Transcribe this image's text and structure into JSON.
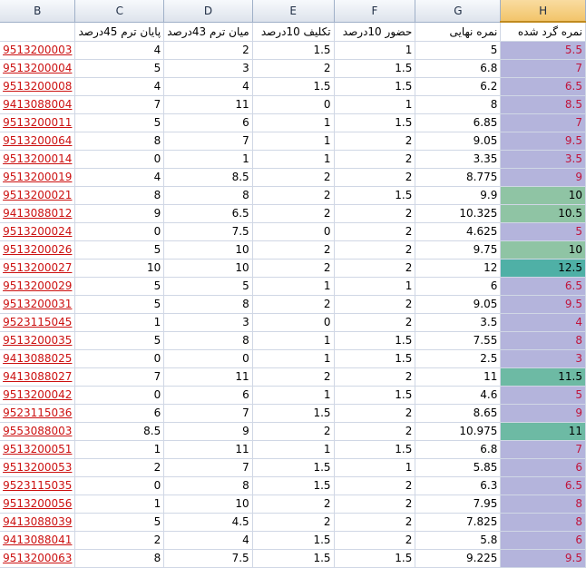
{
  "columns": [
    "B",
    "C",
    "D",
    "E",
    "F",
    "G",
    "H"
  ],
  "header_row": [
    "",
    "پایان ترم 45درصد",
    "میان ترم 43درصد",
    "تکلیف 10درصد",
    "حضور 10درصد",
    "نمره نهایی",
    "نمره گرد شده"
  ],
  "colors": {
    "default_fill": "#b4b4dc",
    "green_light": "#8fc4a4",
    "green_mid": "#6dbaa4",
    "teal": "#4fb0a6",
    "red_text": "#c0143c",
    "black_text": "#000000",
    "link_text": "#cc1111",
    "selected_header": "#f2c46a"
  },
  "rows": [
    {
      "b": "9513200003",
      "c": "4",
      "d": "2",
      "e": "1.5",
      "f": "1",
      "g": "5",
      "h": "5.5",
      "fill": "#b4b4dc",
      "ink": "#c0143c"
    },
    {
      "b": "9513200004",
      "c": "5",
      "d": "3",
      "e": "2",
      "f": "1.5",
      "g": "6.8",
      "h": "7",
      "fill": "#b4b4dc",
      "ink": "#c0143c"
    },
    {
      "b": "9513200008",
      "c": "4",
      "d": "4",
      "e": "1.5",
      "f": "1.5",
      "g": "6.2",
      "h": "6.5",
      "fill": "#b4b4dc",
      "ink": "#c0143c"
    },
    {
      "b": "9413088004",
      "c": "7",
      "d": "11",
      "e": "0",
      "f": "1",
      "g": "8",
      "h": "8.5",
      "fill": "#b4b4dc",
      "ink": "#c0143c"
    },
    {
      "b": "9513200011",
      "c": "5",
      "d": "6",
      "e": "1",
      "f": "1.5",
      "g": "6.85",
      "h": "7",
      "fill": "#b4b4dc",
      "ink": "#c0143c"
    },
    {
      "b": "9513200064",
      "c": "8",
      "d": "7",
      "e": "1",
      "f": "2",
      "g": "9.05",
      "h": "9.5",
      "fill": "#b4b4dc",
      "ink": "#c0143c"
    },
    {
      "b": "9513200014",
      "c": "0",
      "d": "1",
      "e": "1",
      "f": "2",
      "g": "3.35",
      "h": "3.5",
      "fill": "#b4b4dc",
      "ink": "#c0143c"
    },
    {
      "b": "9513200019",
      "c": "4",
      "d": "8.5",
      "e": "2",
      "f": "2",
      "g": "8.775",
      "h": "9",
      "fill": "#b4b4dc",
      "ink": "#c0143c"
    },
    {
      "b": "9513200021",
      "c": "8",
      "d": "8",
      "e": "2",
      "f": "1.5",
      "g": "9.9",
      "h": "10",
      "fill": "#8fc4a4",
      "ink": "#000000"
    },
    {
      "b": "9413088012",
      "c": "9",
      "d": "6.5",
      "e": "2",
      "f": "2",
      "g": "10.325",
      "h": "10.5",
      "fill": "#8fc4a4",
      "ink": "#000000"
    },
    {
      "b": "9513200024",
      "c": "0",
      "d": "7.5",
      "e": "0",
      "f": "2",
      "g": "4.625",
      "h": "5",
      "fill": "#b4b4dc",
      "ink": "#c0143c"
    },
    {
      "b": "9513200026",
      "c": "5",
      "d": "10",
      "e": "2",
      "f": "2",
      "g": "9.75",
      "h": "10",
      "fill": "#8fc4a4",
      "ink": "#000000"
    },
    {
      "b": "9513200027",
      "c": "10",
      "d": "10",
      "e": "2",
      "f": "2",
      "g": "12",
      "h": "12.5",
      "fill": "#4fb0a6",
      "ink": "#000000"
    },
    {
      "b": "9513200029",
      "c": "5",
      "d": "5",
      "e": "1",
      "f": "1",
      "g": "6",
      "h": "6.5",
      "fill": "#b4b4dc",
      "ink": "#c0143c"
    },
    {
      "b": "9513200031",
      "c": "5",
      "d": "8",
      "e": "2",
      "f": "2",
      "g": "9.05",
      "h": "9.5",
      "fill": "#b4b4dc",
      "ink": "#c0143c"
    },
    {
      "b": "9523115045",
      "c": "1",
      "d": "3",
      "e": "0",
      "f": "2",
      "g": "3.5",
      "h": "4",
      "fill": "#b4b4dc",
      "ink": "#c0143c"
    },
    {
      "b": "9513200035",
      "c": "5",
      "d": "8",
      "e": "1",
      "f": "1.5",
      "g": "7.55",
      "h": "8",
      "fill": "#b4b4dc",
      "ink": "#c0143c"
    },
    {
      "b": "9413088025",
      "c": "0",
      "d": "0",
      "e": "1",
      "f": "1.5",
      "g": "2.5",
      "h": "3",
      "fill": "#b4b4dc",
      "ink": "#c0143c"
    },
    {
      "b": "9413088027",
      "c": "7",
      "d": "11",
      "e": "2",
      "f": "2",
      "g": "11",
      "h": "11.5",
      "fill": "#6dbaa4",
      "ink": "#000000"
    },
    {
      "b": "9513200042",
      "c": "0",
      "d": "6",
      "e": "1",
      "f": "1.5",
      "g": "4.6",
      "h": "5",
      "fill": "#b4b4dc",
      "ink": "#c0143c"
    },
    {
      "b": "9523115036",
      "c": "6",
      "d": "7",
      "e": "1.5",
      "f": "2",
      "g": "8.65",
      "h": "9",
      "fill": "#b4b4dc",
      "ink": "#c0143c"
    },
    {
      "b": "9553088003",
      "c": "8.5",
      "d": "9",
      "e": "2",
      "f": "2",
      "g": "10.975",
      "h": "11",
      "fill": "#6dbaa4",
      "ink": "#000000"
    },
    {
      "b": "9513200051",
      "c": "1",
      "d": "11",
      "e": "1",
      "f": "1.5",
      "g": "6.8",
      "h": "7",
      "fill": "#b4b4dc",
      "ink": "#c0143c"
    },
    {
      "b": "9513200053",
      "c": "2",
      "d": "7",
      "e": "1.5",
      "f": "1",
      "g": "5.85",
      "h": "6",
      "fill": "#b4b4dc",
      "ink": "#c0143c"
    },
    {
      "b": "9523115035",
      "c": "0",
      "d": "8",
      "e": "1.5",
      "f": "2",
      "g": "6.3",
      "h": "6.5",
      "fill": "#b4b4dc",
      "ink": "#c0143c"
    },
    {
      "b": "9513200056",
      "c": "1",
      "d": "10",
      "e": "2",
      "f": "2",
      "g": "7.95",
      "h": "8",
      "fill": "#b4b4dc",
      "ink": "#c0143c"
    },
    {
      "b": "9413088039",
      "c": "5",
      "d": "4.5",
      "e": "2",
      "f": "2",
      "g": "7.825",
      "h": "8",
      "fill": "#b4b4dc",
      "ink": "#c0143c"
    },
    {
      "b": "9413088041",
      "c": "2",
      "d": "4",
      "e": "1.5",
      "f": "2",
      "g": "5.8",
      "h": "6",
      "fill": "#b4b4dc",
      "ink": "#c0143c"
    },
    {
      "b": "9513200063",
      "c": "8",
      "d": "7.5",
      "e": "1.5",
      "f": "1.5",
      "g": "9.225",
      "h": "9.5",
      "fill": "#b4b4dc",
      "ink": "#c0143c"
    }
  ]
}
